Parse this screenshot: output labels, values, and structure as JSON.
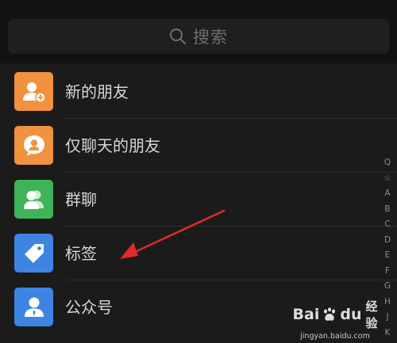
{
  "search": {
    "placeholder": "搜索",
    "icon": "search-icon"
  },
  "contacts": {
    "items": [
      {
        "label": "新的朋友",
        "icon": "add-friend-icon",
        "color": "#f1923f"
      },
      {
        "label": "仅聊天的朋友",
        "icon": "chat-only-friend-icon",
        "color": "#f1923f"
      },
      {
        "label": "群聊",
        "icon": "group-chat-icon",
        "color": "#3fb357"
      },
      {
        "label": "标签",
        "icon": "tag-icon",
        "color": "#3e84e3"
      },
      {
        "label": "公众号",
        "icon": "official-account-icon",
        "color": "#3e84e3"
      }
    ]
  },
  "index_bar": {
    "items": [
      "Q",
      "☆",
      "A",
      "B",
      "C",
      "D",
      "E",
      "F",
      "G",
      "H",
      "J",
      "K"
    ]
  },
  "annotation": {
    "arrow_color": "#e12a2a"
  },
  "watermark": {
    "brand_left": "Bai",
    "brand_right": "du",
    "service": "经验",
    "url": "jingyan.baidu.com"
  }
}
